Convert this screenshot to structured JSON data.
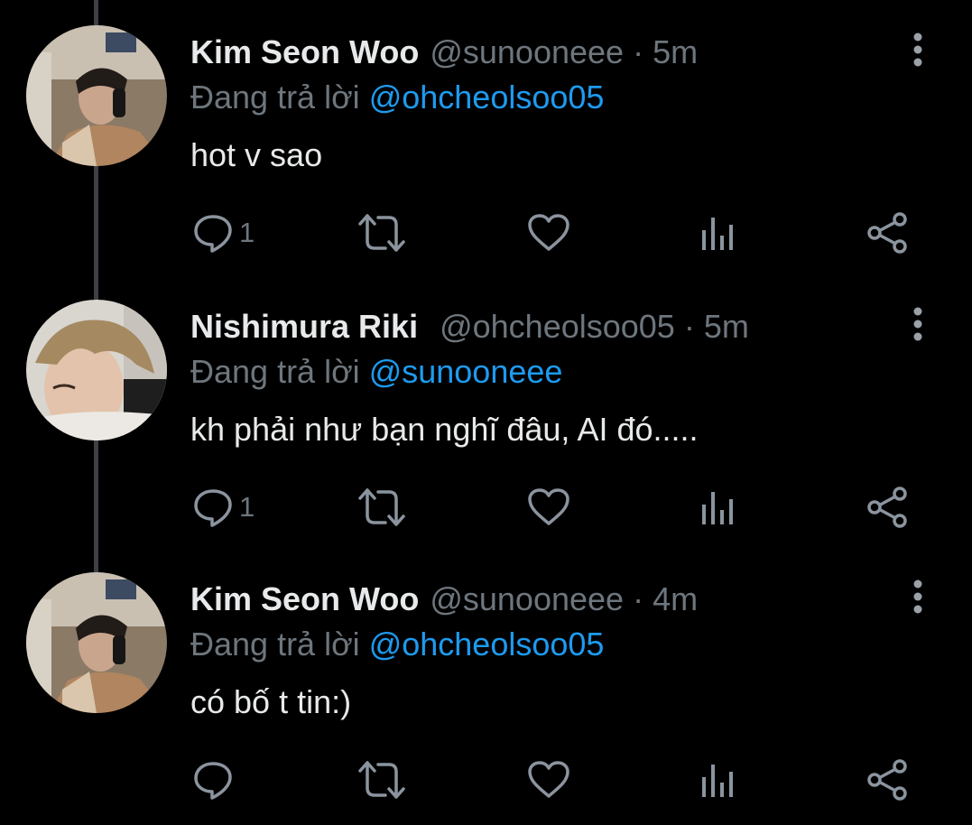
{
  "colors": {
    "background": "#000000",
    "primary_text": "#e7e9ea",
    "secondary_text": "#6e767d",
    "accent": "#1d9bf0",
    "thread_line": "#3d4145"
  },
  "icons": {
    "reply": "speech-bubble-icon",
    "retweet": "retweet-arrows-icon",
    "like": "heart-outline-icon",
    "analytics": "bar-chart-icon",
    "share": "share-nodes-icon",
    "more": "vertical-dots-icon"
  },
  "tweets": [
    {
      "name": "Kim Seon Woo",
      "handle": "@sunooneee",
      "separator": "·",
      "time": "5m",
      "replying_prefix": "Đang trả lời",
      "replying_to": "@ohcheolsoo05",
      "text": "hot v sao",
      "reply_count": "1"
    },
    {
      "name": "Nishimura Riki",
      "handle": "@ohcheolsoo05",
      "separator": "·",
      "time": "5m",
      "replying_prefix": "Đang trả lời",
      "replying_to": "@sunooneee",
      "text": "kh phải như bạn nghĩ đâu, AI đó.....",
      "reply_count": "1"
    },
    {
      "name": "Kim Seon Woo",
      "handle": "@sunooneee",
      "separator": "·",
      "time": "4m",
      "replying_prefix": "Đang trả lời",
      "replying_to": "@ohcheolsoo05",
      "text": "có bố t tin:)",
      "reply_count": ""
    }
  ]
}
